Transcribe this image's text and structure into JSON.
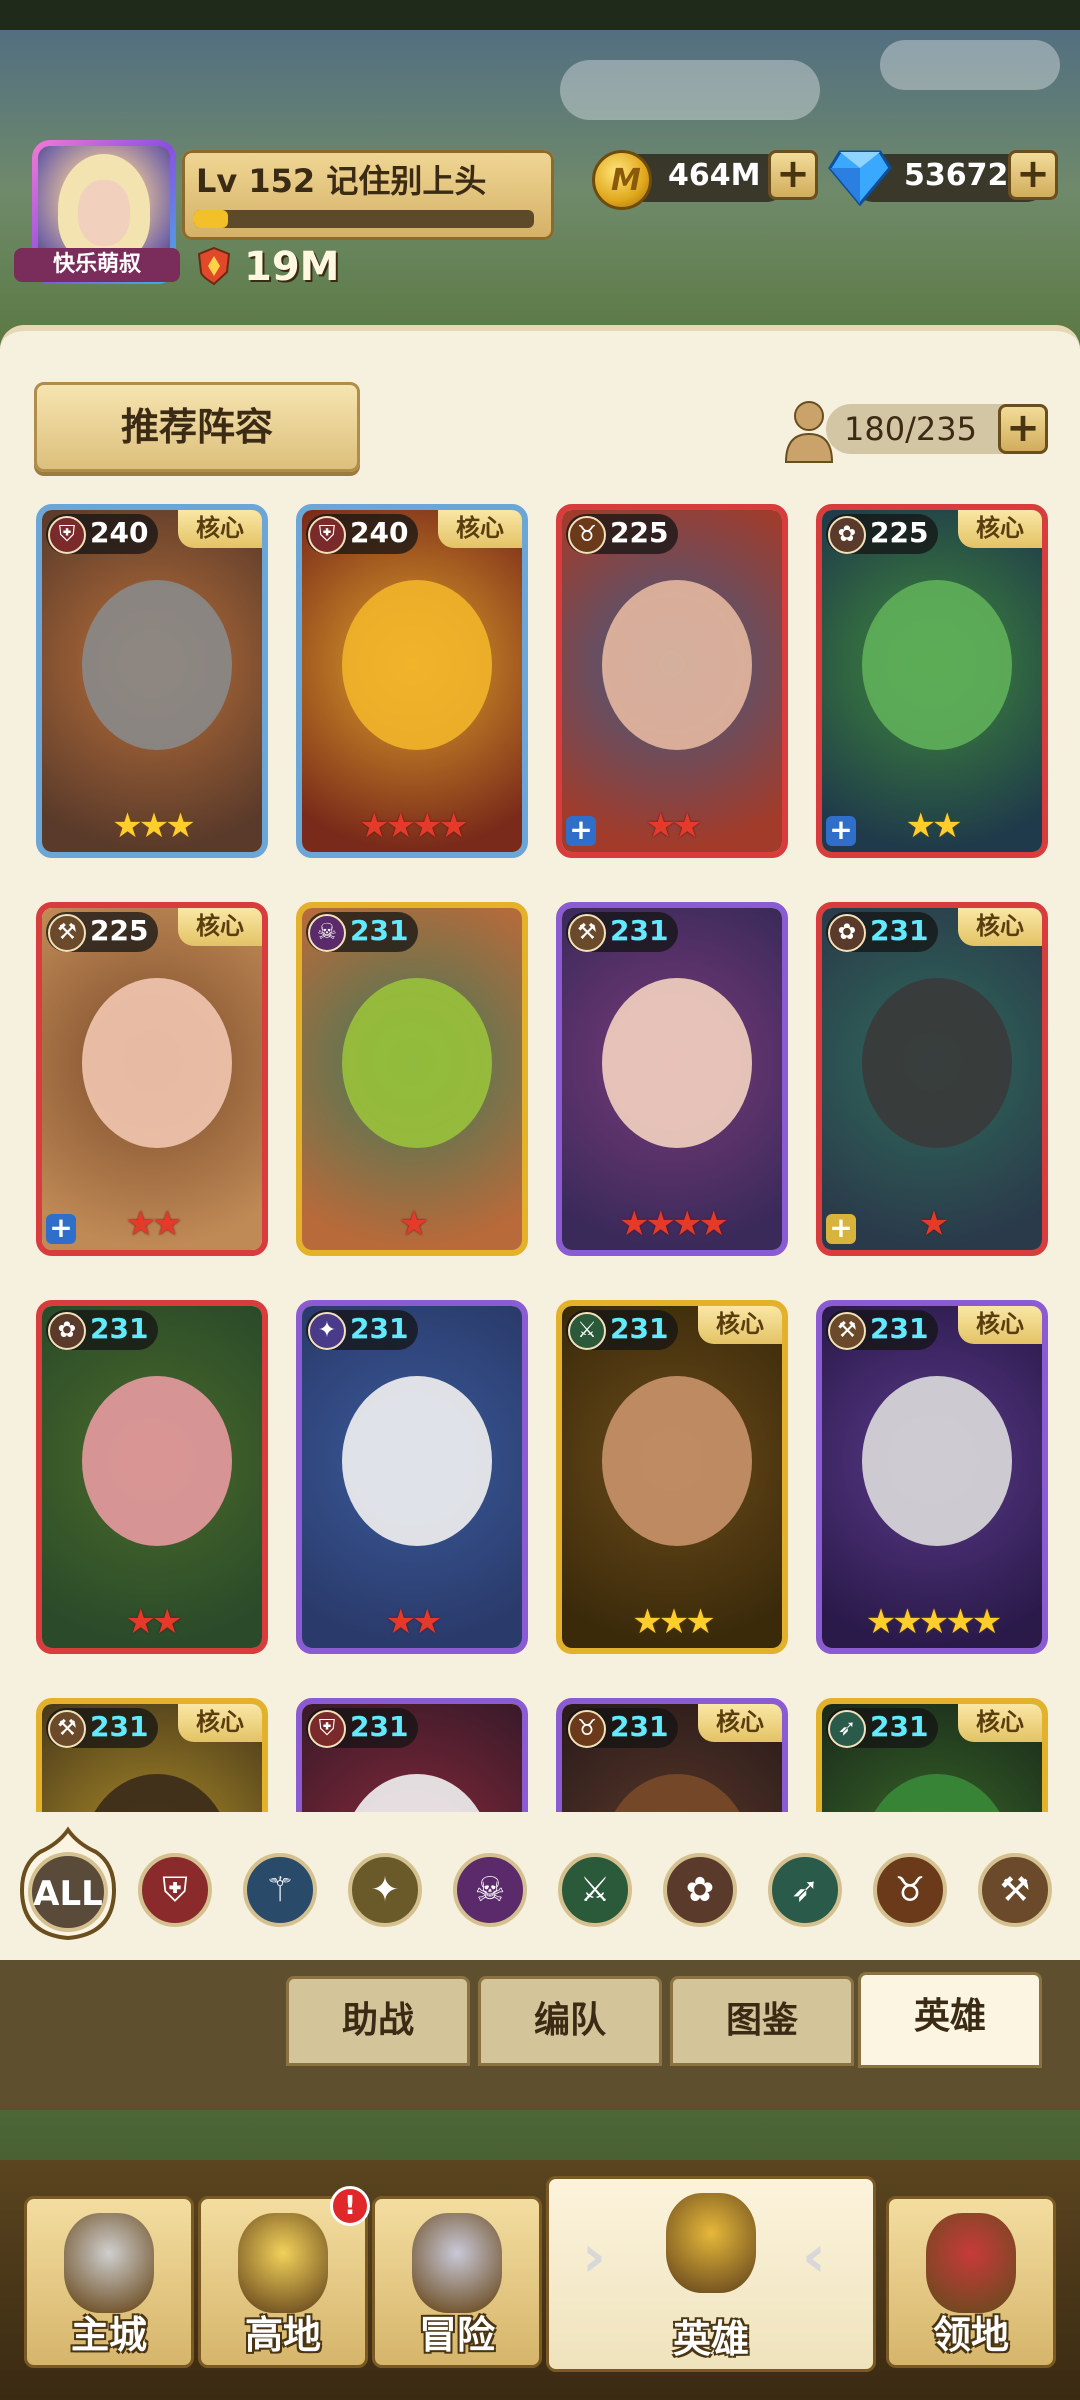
{
  "profile": {
    "name_tag": "快乐萌叔",
    "level_label": "Lv 152 记住别上头",
    "xp_fraction": 0.1,
    "power": "19M"
  },
  "resources": {
    "gold": "464M",
    "gems": "53672",
    "plus": "+"
  },
  "panel": {
    "recommend_label": "推荐阵容",
    "capacity": "180/235",
    "core_label": "核心"
  },
  "heroes": [
    {
      "level": "240",
      "type": "shield",
      "core": true,
      "stars": "★★★",
      "star_color": "gold",
      "frame": "blue",
      "plus": ""
    },
    {
      "level": "240",
      "type": "shield",
      "core": true,
      "stars": "★★★★",
      "star_color": "red",
      "frame": "blue",
      "plus": ""
    },
    {
      "level": "225",
      "type": "horned",
      "core": false,
      "stars": "★★",
      "star_color": "red",
      "frame": "red",
      "plus": "blue"
    },
    {
      "level": "225",
      "type": "paw",
      "core": true,
      "stars": "★★",
      "star_color": "gold",
      "frame": "red",
      "plus": "blue"
    },
    {
      "level": "225",
      "type": "hammer",
      "core": true,
      "stars": "★★",
      "star_color": "red",
      "frame": "red",
      "plus": "blue"
    },
    {
      "level": "231",
      "type": "skull",
      "core": false,
      "stars": "★",
      "star_color": "red",
      "frame": "gold",
      "plus": ""
    },
    {
      "level": "231",
      "type": "hammer",
      "core": false,
      "stars": "★★★★",
      "star_color": "red",
      "frame": "purple",
      "plus": ""
    },
    {
      "level": "231",
      "type": "paw",
      "core": true,
      "stars": "★",
      "star_color": "red",
      "frame": "red",
      "plus": "yellow"
    },
    {
      "level": "231",
      "type": "paw",
      "core": false,
      "stars": "★★",
      "star_color": "red",
      "frame": "red",
      "plus": ""
    },
    {
      "level": "231",
      "type": "wing",
      "core": false,
      "stars": "★★",
      "star_color": "red",
      "frame": "purple",
      "plus": ""
    },
    {
      "level": "231",
      "type": "swords",
      "core": true,
      "stars": "★★★",
      "star_color": "gold",
      "frame": "gold",
      "plus": ""
    },
    {
      "level": "231",
      "type": "hammer",
      "core": true,
      "stars": "★★★★★",
      "star_color": "gold",
      "frame": "purple",
      "plus": ""
    },
    {
      "level": "231",
      "type": "hammer",
      "core": true,
      "stars": "",
      "star_color": "gold",
      "frame": "gold",
      "plus": ""
    },
    {
      "level": "231",
      "type": "shield",
      "core": false,
      "stars": "",
      "star_color": "gold",
      "frame": "purple",
      "plus": ""
    },
    {
      "level": "231",
      "type": "horned",
      "core": true,
      "stars": "",
      "star_color": "gold",
      "frame": "purple",
      "plus": ""
    },
    {
      "level": "231",
      "type": "bow",
      "core": true,
      "stars": "",
      "star_color": "gold",
      "frame": "gold",
      "plus": ""
    }
  ],
  "filters": {
    "all_label": "ALL",
    "icons": [
      "shield-icon",
      "staff-icon",
      "wing-icon",
      "skull-icon",
      "swords-icon",
      "paw-icon",
      "bow-icon",
      "horned-icon",
      "hammer-icon"
    ]
  },
  "subtabs": [
    "助战",
    "编队",
    "图鉴",
    "英雄"
  ],
  "subtab_active": "英雄",
  "nav": {
    "items": [
      "主城",
      "高地",
      "冒险",
      "英雄",
      "领地"
    ],
    "active": "英雄",
    "badge": "!"
  },
  "colors": {
    "panel_bg": "#f6f0de",
    "gold_button": "#dcc07c",
    "level_cyan": "#62eaff",
    "star_red": "#e33a2a",
    "star_gold": "#ffce2c"
  }
}
